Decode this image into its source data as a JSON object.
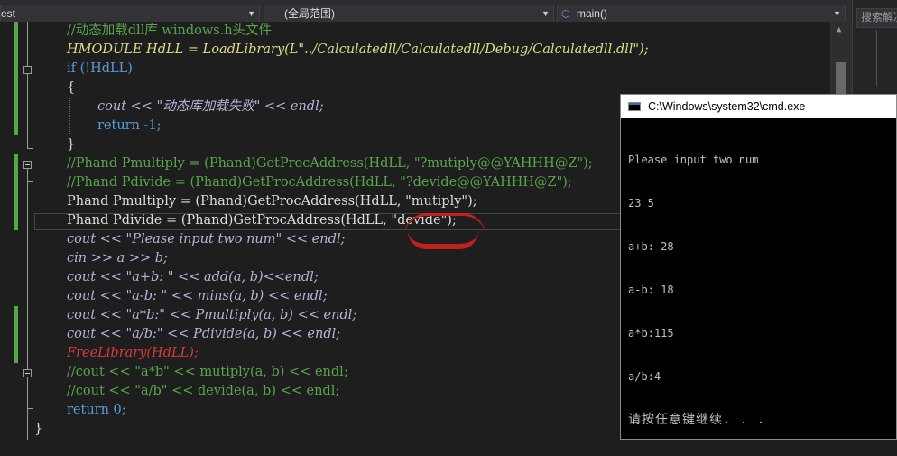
{
  "navbar": {
    "project_combo": "est",
    "scope_combo": "(全局范围)",
    "member_combo": "main()"
  },
  "right_panel": {
    "search_placeholder": "搜索解决"
  },
  "code_lines": [
    "//动态加载dll库 windows.h头文件",
    "HMODULE HdLL = LoadLibrary(L\"../Calculatedll/Calculatedll/Debug/Calculatedll.dll\");",
    "if (!HdLL)",
    "{",
    "cout << \"动态库加载失败\" << endl;",
    "return -1;",
    "}",
    "//Phand Pmultiply = (Phand)GetProcAddress(HdLL, \"?mutiply@@YAHHH@Z\");",
    "//Phand Pdivide = (Phand)GetProcAddress(HdLL, \"?devide@@YAHHH@Z\");",
    "Phand Pmultiply = (Phand)GetProcAddress(HdLL, \"mutiply\");",
    "Phand Pdivide = (Phand)GetProcAddress(HdLL, \"devide\");",
    "cout << \"Please input two num\" << endl;",
    "cin >> a >> b;",
    "cout << \"a+b: \" << add(a, b)<<endl;",
    "cout << \"a-b: \" << mins(a, b) << endl;",
    "cout << \"a*b:\" << Pmultiply(a, b) << endl;",
    "cout << \"a/b:\" << Pdivide(a, b) << endl;",
    "FreeLibrary(HdLL);",
    "//cout << \"a*b\" << mutiply(a, b) << endl;",
    "//cout << \"a/b\" << devide(a, b) << endl;",
    "return 0;",
    "}"
  ],
  "cmd": {
    "title": "C:\\Windows\\system32\\cmd.exe",
    "output": [
      "Please input two num",
      "23 5",
      "a+b: 28",
      "a-b: 18",
      "a*b:115",
      "a/b:4",
      "请按任意键继续. . ."
    ]
  },
  "colors": {
    "editor_bg": "#1e1e1e",
    "comment": "#57a64a",
    "keyword": "#569cd6",
    "string": "#d69d85",
    "annotation": "#c0201e"
  }
}
